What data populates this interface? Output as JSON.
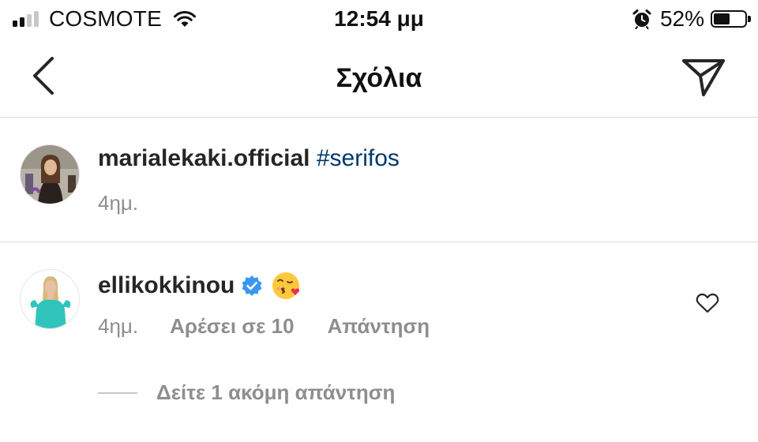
{
  "status_bar": {
    "carrier": "COSMOTE",
    "time": "12:54 μμ",
    "battery_percent": "52%",
    "battery_level": 0.52,
    "signal_bars_active": 2
  },
  "header": {
    "title": "Σχόλια"
  },
  "caption": {
    "username": "marialekaki.official",
    "hashtag": "#serifos",
    "time": "4ημ."
  },
  "comments": [
    {
      "username": "ellikokkinou",
      "verified": true,
      "emoji_icon": "face-blowing-kiss",
      "time": "4ημ.",
      "likes": "Αρέσει σε 10",
      "reply": "Απάντηση",
      "view_replies": "Δείτε 1 ακόμη απάντηση"
    }
  ],
  "colors": {
    "text": "#262626",
    "secondary": "#8e8e8e",
    "hashtag": "#00376b",
    "verified": "#3897f0",
    "divider": "#dbdbdb"
  }
}
